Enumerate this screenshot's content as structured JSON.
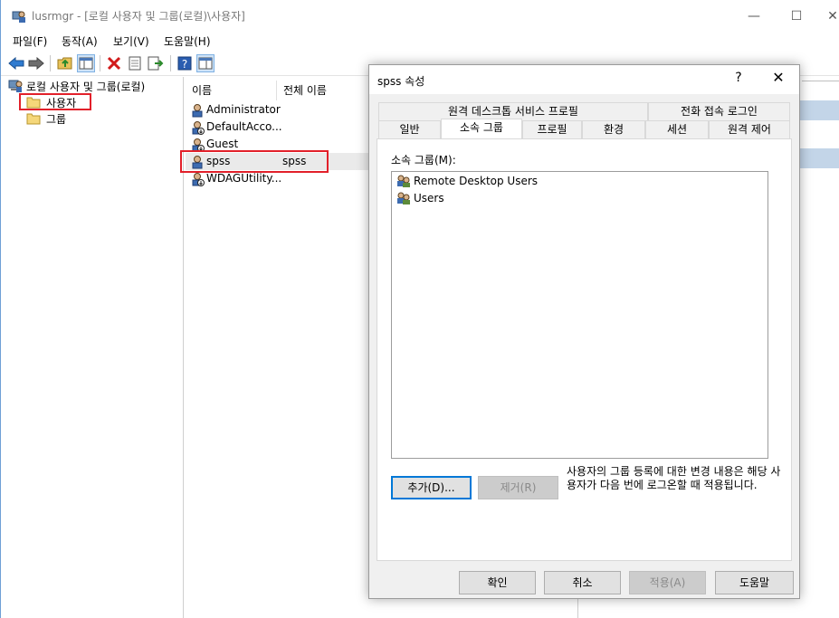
{
  "window": {
    "title": "lusrmgr - [로컬 사용자 및 그룹(로컬)\\사용자]",
    "controls": {
      "minimize": "—",
      "maximize": "☐",
      "close": "✕"
    }
  },
  "menu": [
    "파일(F)",
    "동작(A)",
    "보기(V)",
    "도움말(H)"
  ],
  "toolbar_icons": [
    "back-icon",
    "forward-icon",
    "up-folder-icon",
    "show-hide-tree-icon",
    "delete-icon",
    "properties-icon",
    "export-icon",
    "help-icon",
    "view-icon"
  ],
  "tree": {
    "root": "로컬 사용자 및 그룹(로컬)",
    "children": [
      "사용자",
      "그룹"
    ]
  },
  "list": {
    "columns": [
      "이름",
      "전체 이름"
    ],
    "rows": [
      {
        "name": "Administrator",
        "fullname": ""
      },
      {
        "name": "DefaultAcco...",
        "fullname": ""
      },
      {
        "name": "Guest",
        "fullname": ""
      },
      {
        "name": "spss",
        "fullname": "spss"
      },
      {
        "name": "WDAGUtility...",
        "fullname": ""
      }
    ]
  },
  "dialog": {
    "title": "spss 속성",
    "help": "?",
    "close": "✕",
    "tabs_top": [
      "원격 데스크톱 서비스 프로필",
      "전화 접속 로그인"
    ],
    "tabs_bottom": [
      "일반",
      "소속 그룹",
      "프로필",
      "환경",
      "세션",
      "원격 제어"
    ],
    "active_tab": "소속 그룹",
    "member_of_label": "소속 그룹(M):",
    "groups": [
      "Remote Desktop Users",
      "Users"
    ],
    "add_button": "추가(D)...",
    "remove_button": "제거(R)",
    "note": "사용자의 그룹 등록에 대한 변경 내용은 해당 사용자가 다음 번에 로그온할 때 적용됩니다.",
    "ok": "확인",
    "cancel": "취소",
    "apply": "적용(A)",
    "help_button": "도움말"
  },
  "colors": {
    "highlight_box": "#e2202a",
    "accent": "#0078d7",
    "action_band": "#c3d5e8"
  }
}
